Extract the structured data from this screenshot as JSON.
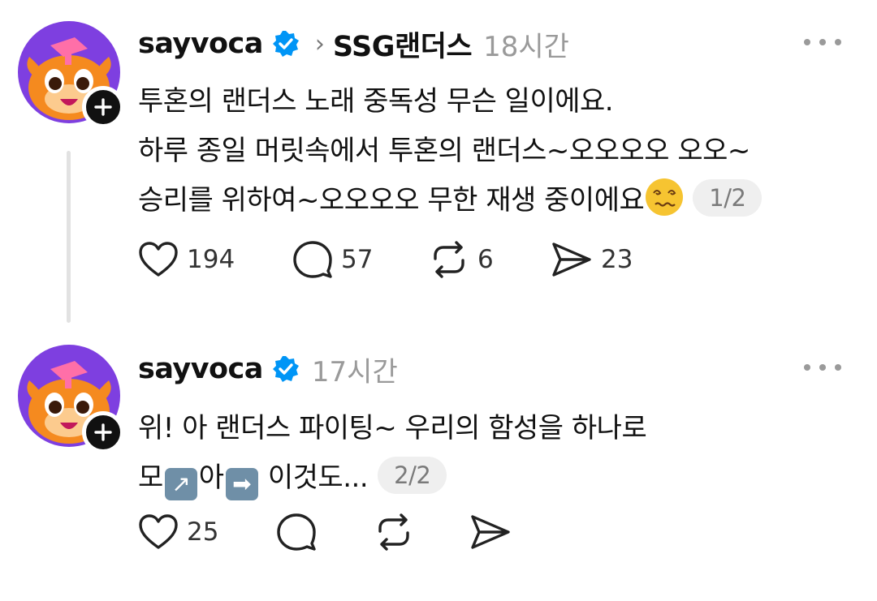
{
  "posts": [
    {
      "username": "sayvoca",
      "community": "SSG랜더스",
      "time": "18시간",
      "lines": [
        "투혼의 랜더스 노래 중독성 무슨 일이에요.",
        "하루 종일 머릿속에서 투혼의 랜더스~오오오오 오오~",
        "승리를 위하여~오오오오 무한 재생 중이에요"
      ],
      "emoji": "dizzy-face",
      "page": "1/2",
      "likes": "194",
      "comments": "57",
      "reposts": "6",
      "shares": "23"
    },
    {
      "username": "sayvoca",
      "time": "17시간",
      "line1": "위! 아 랜더스 파이팅~ 우리의 함성을 하나로",
      "line2_a": "모",
      "arrow_1": "↗",
      "line2_b": "아",
      "arrow_2": "➡",
      "line2_c": " 이것도...",
      "page": "2/2",
      "likes": "25"
    }
  ],
  "colors": {
    "verified": "#0095F6",
    "avatar_bg": "#7E3FE0",
    "character": "#F58A1F",
    "thread_line": "#E2E2E2"
  }
}
